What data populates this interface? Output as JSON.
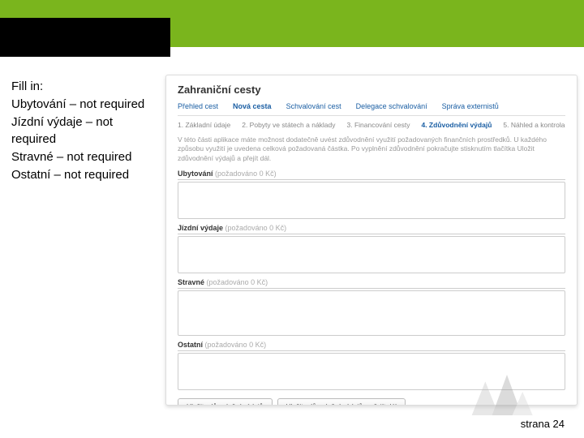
{
  "instructions": {
    "heading": "Fill in:",
    "line1": "Ubytování – not required",
    "line2": "Jízdní výdaje – not required",
    "line3": "Stravné – not required",
    "line4": "Ostatní – not required"
  },
  "app": {
    "title": "Zahraniční cesty",
    "tabs": [
      "Přehled cest",
      "Nová cesta",
      "Schvalování cest",
      "Delegace schvalování",
      "Správa externistů"
    ],
    "active_tab": 1,
    "steps": [
      "1. Základní údaje",
      "2. Pobyty ve státech a náklady",
      "3. Financování cesty",
      "4. Zdůvodnění výdajů",
      "5. Náhled a kontrola"
    ],
    "active_step": 3,
    "intro": "V této části aplikace máte možnost dodatečně uvést zdůvodnění využití požadovaných finančních prostředků. U každého způsobu využití je uvedena celková požadovaná částka. Po vyplnění zdůvodnění pokračujte stisknutím tlačítka Uložit zdůvodnění výdajů a přejít dál.",
    "fields": {
      "ubyt": {
        "label": "Ubytování",
        "hint": "(požadováno 0 Kč)",
        "value": ""
      },
      "jizdni": {
        "label": "Jízdní výdaje",
        "hint": "(požadováno 0 Kč)",
        "value": ""
      },
      "stravne": {
        "label": "Stravné",
        "hint": "(požadováno 0 Kč)",
        "value": ""
      },
      "ostatni": {
        "label": "Ostatní",
        "hint": "(požadováno 0 Kč)",
        "value": ""
      }
    },
    "buttons": {
      "save": "Uložit zdůvodnění výdajů",
      "save_next": "Uložit zdůvodnění výdajů a přejít dál"
    }
  },
  "footer": {
    "page_label": "strana 24"
  }
}
